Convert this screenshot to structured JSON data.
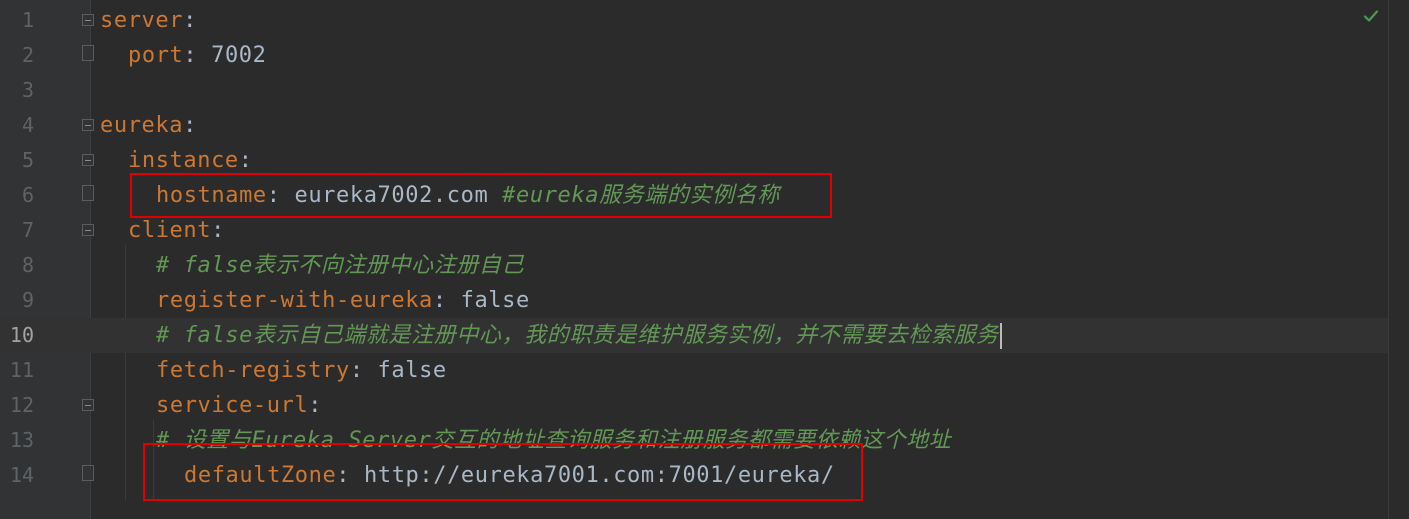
{
  "editor": {
    "status_icon": "check-icon",
    "status_color": "#499c54",
    "lines": [
      {
        "n": "1",
        "indent": 0,
        "key": "server",
        "colon": ":",
        "value": "",
        "comment": ""
      },
      {
        "n": "2",
        "indent": 1,
        "key": "port",
        "colon": ":",
        "value": " 7002",
        "comment": ""
      },
      {
        "n": "3",
        "indent": 0,
        "key": "",
        "colon": "",
        "value": "",
        "comment": ""
      },
      {
        "n": "4",
        "indent": 0,
        "key": "eureka",
        "colon": ":",
        "value": "",
        "comment": ""
      },
      {
        "n": "5",
        "indent": 1,
        "key": "instance",
        "colon": ":",
        "value": "",
        "comment": ""
      },
      {
        "n": "6",
        "indent": 2,
        "key": "hostname",
        "colon": ":",
        "value": " eureka7002.com ",
        "comment": "#eureka服务端的实例名称"
      },
      {
        "n": "7",
        "indent": 1,
        "key": "client",
        "colon": ":",
        "value": "",
        "comment": ""
      },
      {
        "n": "8",
        "indent": 2,
        "key": "",
        "colon": "",
        "value": "",
        "comment": "# false表示不向注册中心注册自己"
      },
      {
        "n": "9",
        "indent": 2,
        "key": "register-with-eureka",
        "colon": ":",
        "value": " false",
        "comment": ""
      },
      {
        "n": "10",
        "indent": 2,
        "key": "",
        "colon": "",
        "value": "",
        "comment": "# false表示自己端就是注册中心，我的职责是维护服务实例，并不需要去检索服务"
      },
      {
        "n": "11",
        "indent": 2,
        "key": "fetch-registry",
        "colon": ":",
        "value": " false",
        "comment": ""
      },
      {
        "n": "12",
        "indent": 2,
        "key": "service-url",
        "colon": ":",
        "value": "",
        "comment": ""
      },
      {
        "n": "13",
        "indent": 2,
        "key": "",
        "colon": "",
        "value": "",
        "comment": "# 设置与Eureka Server交互的地址查询服务和注册服务都需要依赖这个地址"
      },
      {
        "n": "14",
        "indent": 3,
        "key": "defaultZone",
        "colon": ":",
        "value": " http://eureka7001.com:7001/eureka/",
        "comment": ""
      }
    ],
    "current_line": "10",
    "highlight_color": "#e00000"
  }
}
